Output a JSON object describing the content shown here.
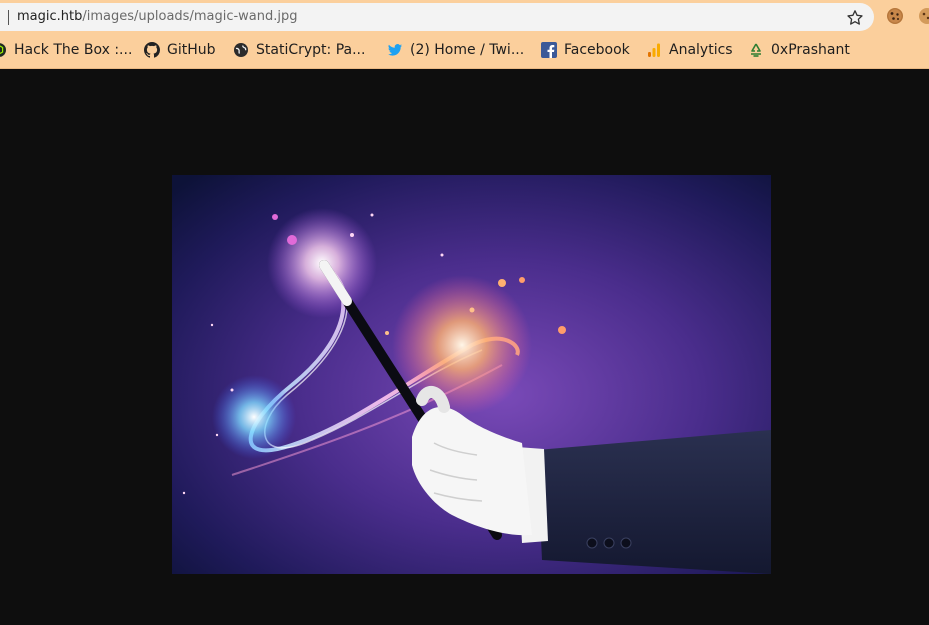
{
  "address_bar": {
    "host": "magic.htb",
    "path": "/images/uploads/magic-wand.jpg",
    "bookmark_icon": "star-icon"
  },
  "extensions": [
    {
      "name": "cookie-icon"
    },
    {
      "name": "cookie-icon"
    }
  ],
  "bookmarks": [
    {
      "label": "Hack The Box :...",
      "icon": "htb-icon"
    },
    {
      "label": "GitHub",
      "icon": "github-icon"
    },
    {
      "label": "StatiCrypt: Pa...",
      "icon": "globe-icon"
    },
    {
      "label": "(2) Home / Twi...",
      "icon": "twitter-icon"
    },
    {
      "label": "Facebook",
      "icon": "facebook-icon"
    },
    {
      "label": "Analytics",
      "icon": "analytics-icon"
    },
    {
      "label": "0xPrashant",
      "icon": "recycle-icon"
    }
  ],
  "viewer": {
    "background": "#0e0e0e",
    "image_subject": "gloved hand holding a magic wand with sparkles"
  },
  "colors": {
    "toolbar": "#fbcf9c",
    "urlbar": "#f3f3f3"
  }
}
